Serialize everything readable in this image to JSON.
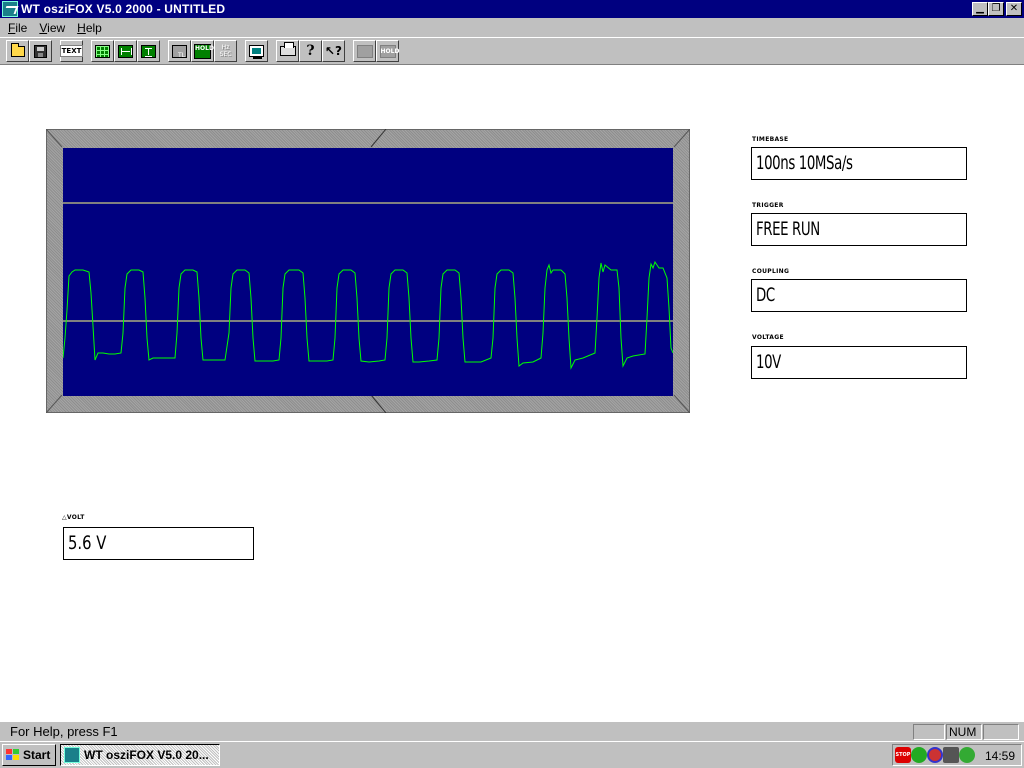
{
  "window": {
    "title": "WT osziFOX V5.0 2000 - UNTITLED",
    "min_glyph": "▁",
    "restore_glyph": "❐",
    "close_glyph": "✕"
  },
  "menu": [
    {
      "label": "File",
      "underline": "F",
      "rest": "ile"
    },
    {
      "label": "View",
      "underline": "V",
      "rest": "iew"
    },
    {
      "label": "Help",
      "underline": "H",
      "rest": "elp"
    }
  ],
  "toolbar": {
    "text_label": "TEXT",
    "tl_label": "TL",
    "hold_label": "HOLD",
    "hz_label": "Hz",
    "sec_label": "SEC",
    "hold2_label": "HOLD",
    "help_glyph": "?",
    "context_help_glyph": "↖?"
  },
  "settings": {
    "timebase": {
      "label": "TIMEBASE",
      "value": "100ns 10MSa/s"
    },
    "trigger": {
      "label": "TRIGGER",
      "value": "FREE RUN"
    },
    "coupling": {
      "label": "COUPLING",
      "value": "DC"
    },
    "voltage": {
      "label": "VOLTAGE",
      "value": "10V"
    }
  },
  "delta_volt": {
    "label": "△VOLT",
    "value": "5.6 V"
  },
  "scope": {
    "screen_color": "#000080",
    "trace_color": "#00ff00",
    "cursor_color": "#ffff80"
  },
  "status": {
    "help_text": "For Help, press F1",
    "num": "NUM"
  },
  "taskbar": {
    "start_label": "Start",
    "task_label": "WT osziFOX V5.0 20...",
    "clock": "14:59",
    "stop_label": "STOP"
  }
}
